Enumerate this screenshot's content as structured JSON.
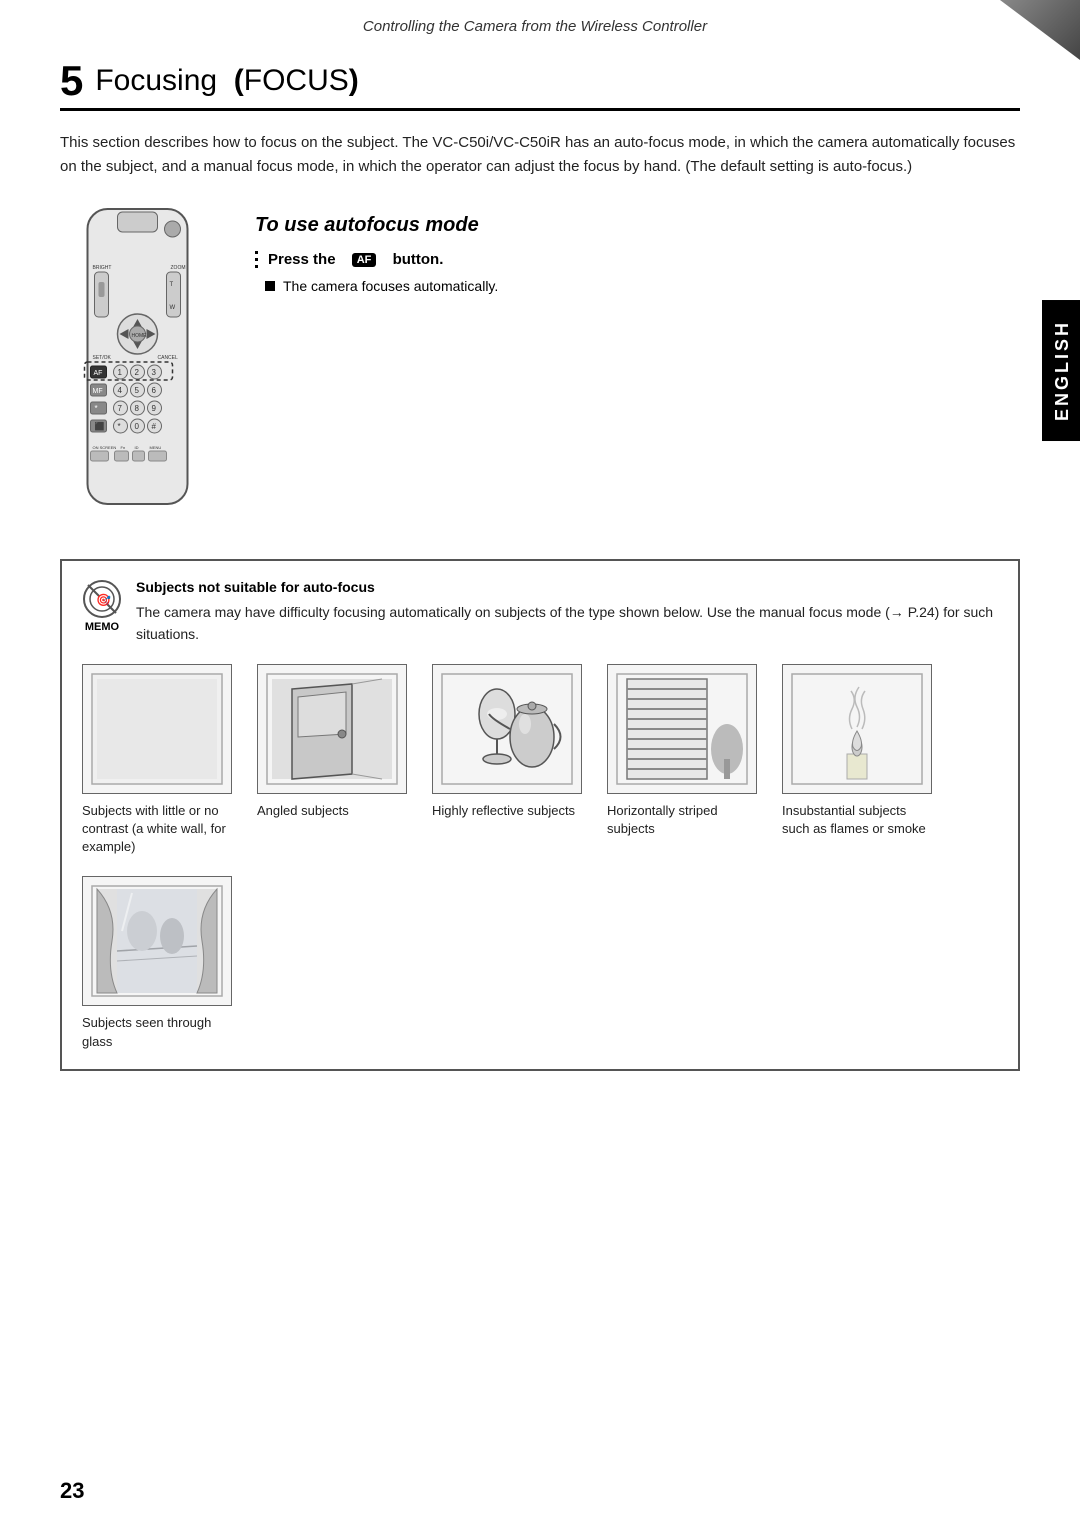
{
  "header": {
    "title": "Controlling the Camera from the Wireless Controller"
  },
  "section": {
    "number": "5",
    "title": "Focusing",
    "title_sub": "FOCUS"
  },
  "intro": {
    "text": "This section describes how to focus on the subject. The VC-C50i/VC-C50iR has an auto-focus mode, in which the camera automatically focuses on the subject, and a manual focus mode, in which the operator can adjust the focus by hand. (The default setting is auto-focus.)"
  },
  "autofocus": {
    "title": "To use autofocus mode",
    "press_label": "Press the",
    "button_label": "AF",
    "button_suffix": "button.",
    "bullet": "The camera focuses automatically."
  },
  "memo": {
    "icon_label": "MEMO",
    "title": "Subjects not suitable for auto-focus",
    "text": "The camera may have difficulty focusing automatically on subjects of the type shown below. Use the manual focus mode (→ P.24) for such situations."
  },
  "subjects": [
    {
      "label": "Subjects with little or no contrast (a white wall, for example)",
      "type": "blank"
    },
    {
      "label": "Angled subjects",
      "type": "door"
    },
    {
      "label": "Highly reflective subjects",
      "type": "teapot"
    },
    {
      "label": "Horizontally striped subjects",
      "type": "stripes"
    },
    {
      "label": "Insubstantial subjects such as flames or smoke",
      "type": "flame"
    },
    {
      "label": "Subjects seen through glass",
      "type": "glass"
    }
  ],
  "page_number": "23",
  "english_tab": "ENGLISH"
}
